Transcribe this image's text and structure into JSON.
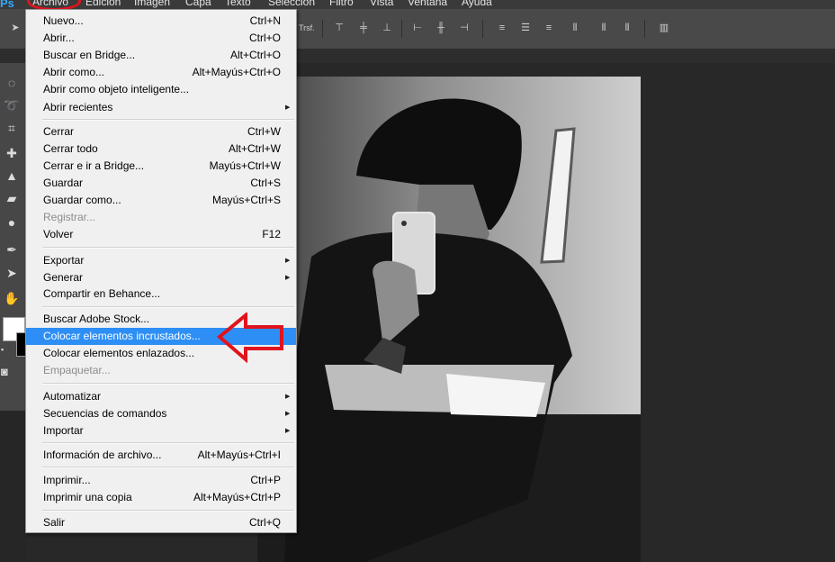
{
  "menubar": {
    "app": "Ps",
    "items": [
      "Archivo",
      "Edición",
      "Imagen",
      "Capa",
      "Texto",
      "Selección",
      "Filtro",
      "Vista",
      "Ventana",
      "Ayuda"
    ]
  },
  "options_bar": {
    "transform_label": "Trsf."
  },
  "archivo_menu": {
    "items": [
      {
        "label": "Nuevo...",
        "shortcut": "Ctrl+N"
      },
      {
        "label": "Abrir...",
        "shortcut": "Ctrl+O"
      },
      {
        "label": "Buscar en Bridge...",
        "shortcut": "Alt+Ctrl+O"
      },
      {
        "label": "Abrir como...",
        "shortcut": "Alt+Mayús+Ctrl+O"
      },
      {
        "label": "Abrir como objeto inteligente...",
        "shortcut": ""
      },
      {
        "label": "Abrir recientes",
        "shortcut": ""
      },
      {
        "label": "Cerrar",
        "shortcut": "Ctrl+W"
      },
      {
        "label": "Cerrar todo",
        "shortcut": "Alt+Ctrl+W"
      },
      {
        "label": "Cerrar e ir a Bridge...",
        "shortcut": "Mayús+Ctrl+W"
      },
      {
        "label": "Guardar",
        "shortcut": "Ctrl+S"
      },
      {
        "label": "Guardar como...",
        "shortcut": "Mayús+Ctrl+S"
      },
      {
        "label": "Registrar...",
        "shortcut": ""
      },
      {
        "label": "Volver",
        "shortcut": "F12"
      },
      {
        "label": "Exportar",
        "shortcut": ""
      },
      {
        "label": "Generar",
        "shortcut": ""
      },
      {
        "label": "Compartir en Behance...",
        "shortcut": ""
      },
      {
        "label": "Buscar Adobe Stock...",
        "shortcut": ""
      },
      {
        "label": "Colocar elementos incrustados...",
        "shortcut": ""
      },
      {
        "label": "Colocar elementos enlazados...",
        "shortcut": ""
      },
      {
        "label": "Empaquetar...",
        "shortcut": ""
      },
      {
        "label": "Automatizar",
        "shortcut": ""
      },
      {
        "label": "Secuencias de comandos",
        "shortcut": ""
      },
      {
        "label": "Importar",
        "shortcut": ""
      },
      {
        "label": "Información de archivo...",
        "shortcut": "Alt+Mayús+Ctrl+I"
      },
      {
        "label": "Imprimir...",
        "shortcut": "Ctrl+P"
      },
      {
        "label": "Imprimir una copia",
        "shortcut": "Alt+Mayús+Ctrl+P"
      },
      {
        "label": "Salir",
        "shortcut": "Ctrl+Q"
      }
    ],
    "highlighted_item": "Colocar elementos incrustados...",
    "disabled_items": [
      "Registrar...",
      "Empaquetar..."
    ],
    "submenu_items": [
      "Abrir recientes",
      "Exportar",
      "Generar",
      "Automatizar",
      "Secuencias de comandos",
      "Importar"
    ]
  },
  "toolbar": {
    "tools": [
      "marquee-tool",
      "lasso-tool",
      "crop-tool",
      "healing-brush-tool",
      "clone-stamp-tool",
      "eraser-tool",
      "blur-tool",
      "pen-tool",
      "path-selection-tool",
      "hand-tool"
    ]
  },
  "colors": {
    "highlight": "#2d8ff5",
    "annotation_red": "#e0141e",
    "menu_bg": "#f0f0f0",
    "options_bar_bg": "#494949"
  },
  "annotations": {
    "archivo_circled": true,
    "arrow_target": "Colocar elementos incrustados..."
  }
}
